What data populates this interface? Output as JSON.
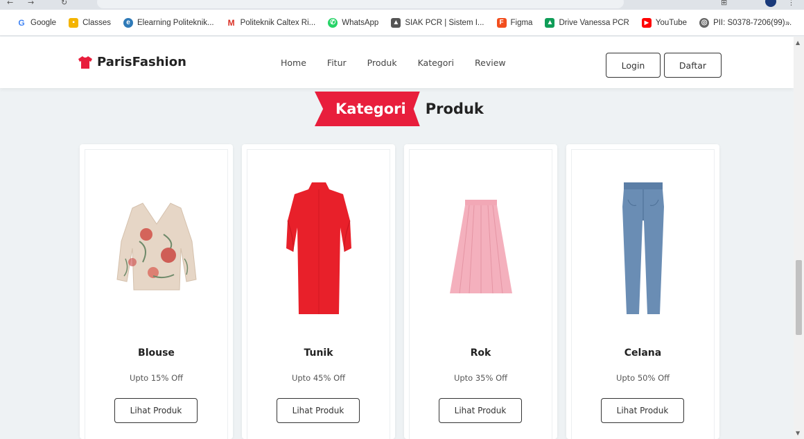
{
  "bookmarks": [
    {
      "label": "Google",
      "icon": "google-icon",
      "color": "#4285f4",
      "glyph": "G"
    },
    {
      "label": "Classes",
      "icon": "classes-icon",
      "color": "#f4b400",
      "glyph": "C"
    },
    {
      "label": "Elearning Politeknik...",
      "icon": "elearning-icon",
      "color": "#2f7ab8",
      "glyph": "e"
    },
    {
      "label": "Politeknik Caltex Ri...",
      "icon": "gmail-icon",
      "color": "#d93025",
      "glyph": "M"
    },
    {
      "label": "WhatsApp",
      "icon": "whatsapp-icon",
      "color": "#25d366",
      "glyph": "w"
    },
    {
      "label": "SIAK PCR | Sistem I...",
      "icon": "siak-icon",
      "color": "#555555",
      "glyph": "S"
    },
    {
      "label": "Figma",
      "icon": "figma-icon",
      "color": "#f24e1e",
      "glyph": "F"
    },
    {
      "label": "Drive Vanessa PCR",
      "icon": "drive-icon",
      "color": "#0f9d58",
      "glyph": "D"
    },
    {
      "label": "YouTube",
      "icon": "youtube-icon",
      "color": "#ff0000",
      "glyph": "▶"
    },
    {
      "label": "PII: S0378-7206(99)...",
      "icon": "globe-icon",
      "color": "#666666",
      "glyph": "◎"
    }
  ],
  "bookmarks_more": "»",
  "brand": {
    "name": "ParisFashion",
    "icon": "tshirt-icon",
    "color": "#e81e3c"
  },
  "nav": {
    "items": [
      "Home",
      "Fitur",
      "Produk",
      "Kategori",
      "Review"
    ],
    "login": "Login",
    "register": "Daftar"
  },
  "section": {
    "highlight": "Kategori",
    "rest": "Produk",
    "ribbon_color": "#e81e3c"
  },
  "categories": [
    {
      "name": "Blouse",
      "discount": "Upto 15% Off",
      "button": "Lihat Produk",
      "image": "blouse-image"
    },
    {
      "name": "Tunik",
      "discount": "Upto 45% Off",
      "button": "Lihat Produk",
      "image": "tunik-image"
    },
    {
      "name": "Rok",
      "discount": "Upto 35% Off",
      "button": "Lihat Produk",
      "image": "rok-image"
    },
    {
      "name": "Celana",
      "discount": "Upto 50% Off",
      "button": "Lihat Produk",
      "image": "celana-image"
    }
  ]
}
